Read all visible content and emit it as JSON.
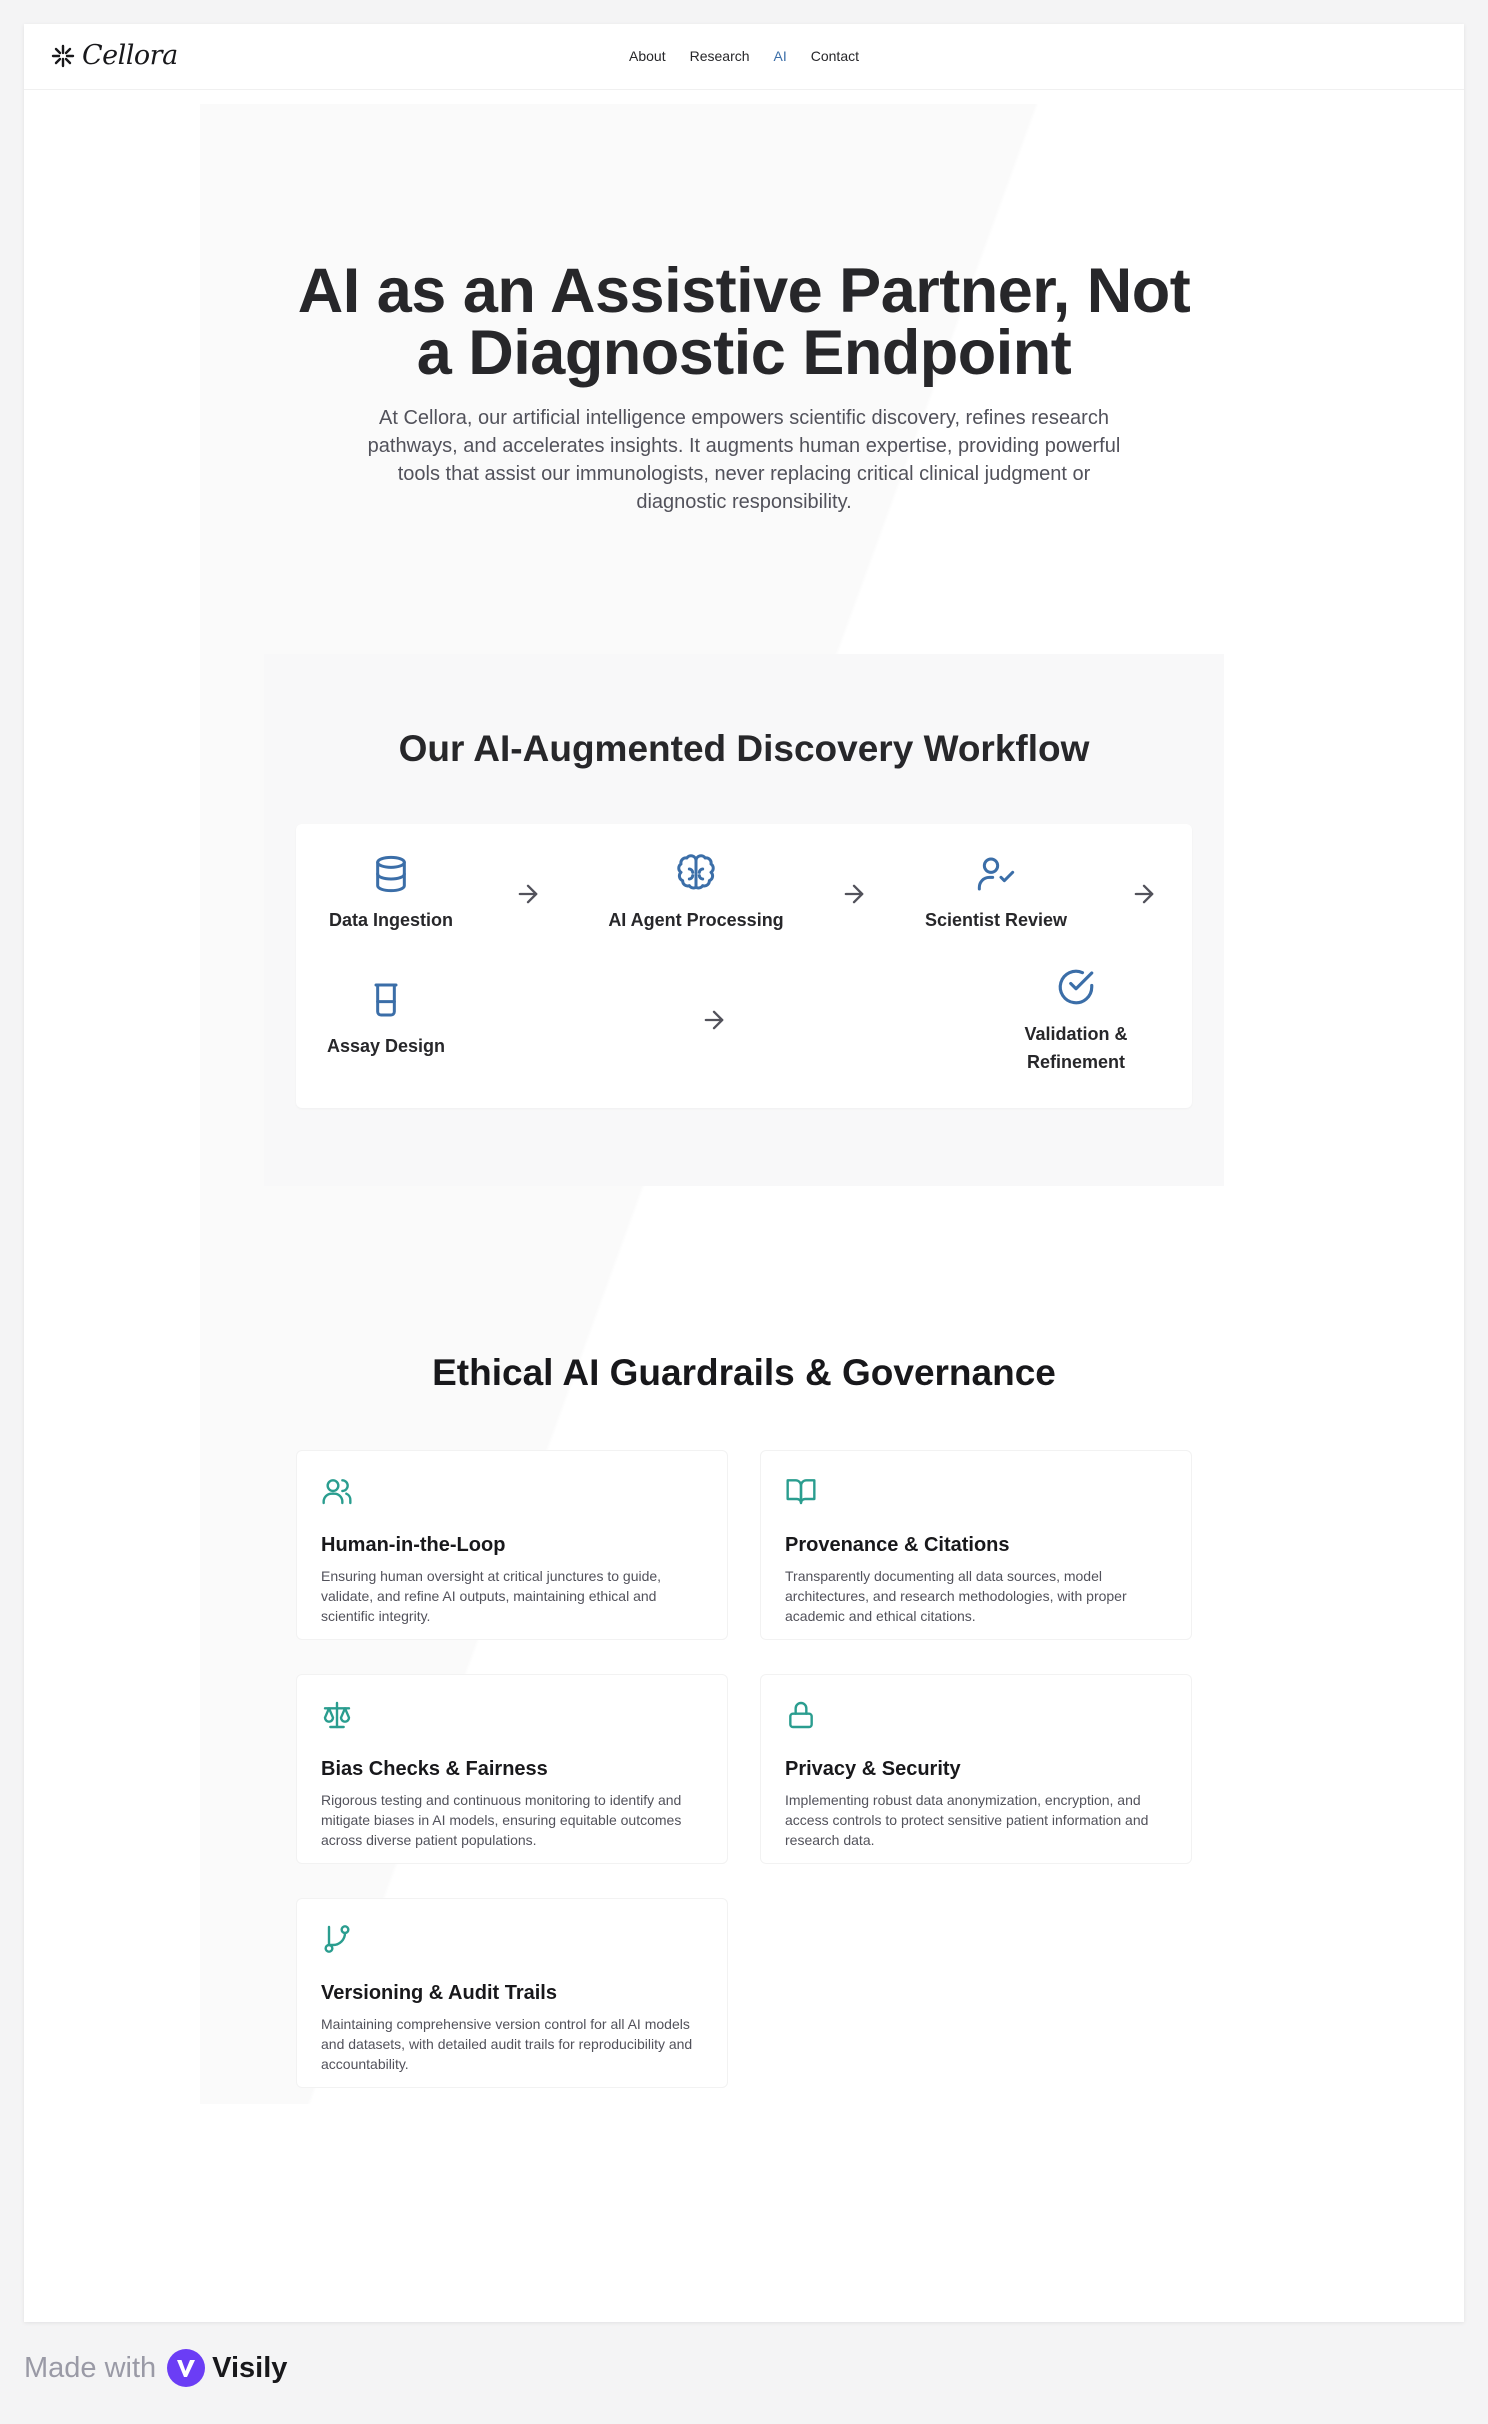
{
  "header": {
    "logo_text": "Cellora",
    "nav": [
      {
        "label": "About",
        "active": false
      },
      {
        "label": "Research",
        "active": false
      },
      {
        "label": "AI",
        "active": true
      },
      {
        "label": "Contact",
        "active": false
      }
    ]
  },
  "hero": {
    "title": "AI as an Assistive Partner, Not a Diagnostic Endpoint",
    "description": "At Cellora, our artificial intelligence empowers scientific discovery, refines research pathways, and accelerates insights. It augments human expertise, providing powerful tools that assist our immunologists, never replacing critical clinical judgment or diagnostic responsibility."
  },
  "workflow": {
    "title": "Our AI-Augmented Discovery Workflow",
    "steps": [
      {
        "label": "Data Ingestion",
        "icon": "database-icon"
      },
      {
        "label": "AI Agent Processing",
        "icon": "brain-icon"
      },
      {
        "label": "Scientist Review",
        "icon": "user-check-icon"
      },
      {
        "label": "Assay Design",
        "icon": "beaker-icon"
      },
      {
        "label": "Validation & Refinement",
        "icon": "check-circle-icon"
      }
    ]
  },
  "guardrails": {
    "title": "Ethical AI Guardrails & Governance",
    "items": [
      {
        "title": "Human-in-the-Loop",
        "icon": "users-icon",
        "description": "Ensuring human oversight at critical junctures to guide, validate, and refine AI outputs, maintaining ethical and scientific integrity."
      },
      {
        "title": "Provenance & Citations",
        "icon": "book-open-icon",
        "description": "Transparently documenting all data sources, model architectures, and research methodologies, with proper academic and ethical citations."
      },
      {
        "title": "Bias Checks & Fairness",
        "icon": "scale-icon",
        "description": "Rigorous testing and continuous monitoring to identify and mitigate biases in AI models, ensuring equitable outcomes across diverse patient populations."
      },
      {
        "title": "Privacy & Security",
        "icon": "lock-icon",
        "description": "Implementing robust data anonymization, encryption, and access controls to protect sensitive patient information and research data."
      },
      {
        "title": "Versioning & Audit Trails",
        "icon": "git-branch-icon",
        "description": "Maintaining comprehensive version control for all AI models and datasets, with detailed audit trails for reproducibility and accountability."
      }
    ]
  },
  "footer": {
    "made_with": "Made with",
    "brand": "Visily"
  },
  "colors": {
    "accent_blue": "#3b6ea8",
    "accent_teal": "#2a9d8f",
    "text_dark": "#27272a",
    "visily_purple": "#6b3df5"
  }
}
